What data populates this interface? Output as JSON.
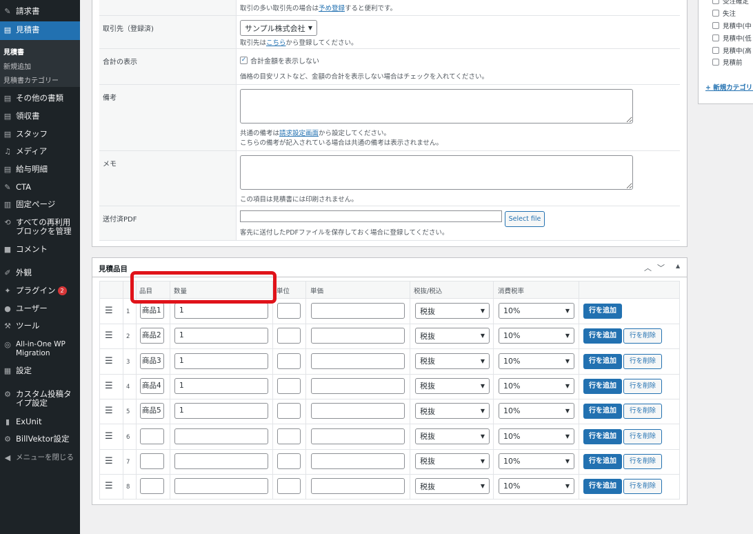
{
  "sidebar": {
    "items": [
      {
        "label": "請求書",
        "icon": "pin-icon"
      },
      {
        "label": "見積書",
        "icon": "document-icon"
      },
      {
        "label": "その他の書類",
        "icon": "document-icon"
      },
      {
        "label": "領収書",
        "icon": "document-icon"
      },
      {
        "label": "スタッフ",
        "icon": "document-icon"
      },
      {
        "label": "メディア",
        "icon": "media-icon"
      },
      {
        "label": "給与明細",
        "icon": "document-icon"
      },
      {
        "label": "CTA",
        "icon": "pin-icon"
      },
      {
        "label": "固定ページ",
        "icon": "page-icon"
      },
      {
        "label": "すべての再利用ブロックを管理",
        "icon": "block-icon"
      },
      {
        "label": "コメント",
        "icon": "comment-icon"
      },
      {
        "label": "外観",
        "icon": "brush-icon"
      },
      {
        "label": "プラグイン",
        "icon": "plugin-icon",
        "badge": "2"
      },
      {
        "label": "ユーザー",
        "icon": "user-icon"
      },
      {
        "label": "ツール",
        "icon": "wrench-icon"
      },
      {
        "label": "All-in-One WP Migration",
        "icon": "migration-icon"
      },
      {
        "label": "設定",
        "icon": "settings-icon"
      },
      {
        "label": "カスタム投稿タイプ設定",
        "icon": "gear-icon"
      },
      {
        "label": "ExUnit",
        "icon": "chart-icon"
      },
      {
        "label": "BillVektor設定",
        "icon": "gear-icon"
      },
      {
        "label": "メニューを閉じる",
        "icon": "collapse-icon"
      }
    ],
    "submenu": [
      {
        "label": "見積書"
      },
      {
        "label": "新規追加"
      },
      {
        "label": "見積書カテゴリー"
      }
    ]
  },
  "form": {
    "top_help": {
      "pre": "取引の多い取引先の場合は",
      "link": "予め登録",
      "post": "すると便利です。"
    },
    "client": {
      "label": "取引先（登録済)",
      "select_value": "サンプル株式会社",
      "help_pre": "取引先は",
      "help_link": "こちら",
      "help_post": "から登録してください。"
    },
    "total_display": {
      "label": "合計の表示",
      "checkbox_label": "合計金額を表示しない",
      "help": "価格の目安リストなど、金額の合計を表示しない場合はチェックを入れてください。"
    },
    "remarks": {
      "label": "備考",
      "help1_pre": "共通の備考は",
      "help1_link": "請求設定画面",
      "help1_post": "から設定してください。",
      "help2": "こちらの備考が記入されている場合は共通の備考は表示されません。"
    },
    "memo": {
      "label": "メモ",
      "help": "この項目は見積書には印刷されません。"
    },
    "pdf": {
      "label": "送付済PDF",
      "button": "Select file",
      "help": "客先に送付したPDFファイルを保存しておく場合に登録してください。"
    }
  },
  "items_panel": {
    "title": "見積品目",
    "headers": {
      "item": "品目",
      "qty": "数量",
      "unit": "単位",
      "price": "単価",
      "tax_type": "税抜/税込",
      "tax_rate": "消費税率"
    },
    "add_row": "行を追加",
    "delete_row": "行を削除",
    "rows": [
      {
        "num": "1",
        "item": "商品1",
        "qty": "1",
        "tax_type": "税抜",
        "tax_rate": "10%"
      },
      {
        "num": "2",
        "item": "商品2",
        "qty": "1",
        "tax_type": "税抜",
        "tax_rate": "10%"
      },
      {
        "num": "3",
        "item": "商品3",
        "qty": "1",
        "tax_type": "税抜",
        "tax_rate": "10%"
      },
      {
        "num": "4",
        "item": "商品4",
        "qty": "1",
        "tax_type": "税抜",
        "tax_rate": "10%"
      },
      {
        "num": "5",
        "item": "商品5",
        "qty": "1",
        "tax_type": "税抜",
        "tax_rate": "10%"
      },
      {
        "num": "6",
        "item": "",
        "qty": "",
        "tax_type": "税抜",
        "tax_rate": "10%"
      },
      {
        "num": "7",
        "item": "",
        "qty": "",
        "tax_type": "税抜",
        "tax_rate": "10%"
      },
      {
        "num": "8",
        "item": "",
        "qty": "",
        "tax_type": "税抜",
        "tax_rate": "10%"
      }
    ]
  },
  "categories": {
    "items": [
      "受注確定",
      "失注",
      "見積中(中",
      "見積中(低",
      "見積中(高",
      "見積前"
    ],
    "add_link": "+ 新規カテゴリー"
  },
  "colors": {
    "accent": "#2271b1",
    "sidebar": "#1d2327",
    "highlight": "#e0131a"
  }
}
